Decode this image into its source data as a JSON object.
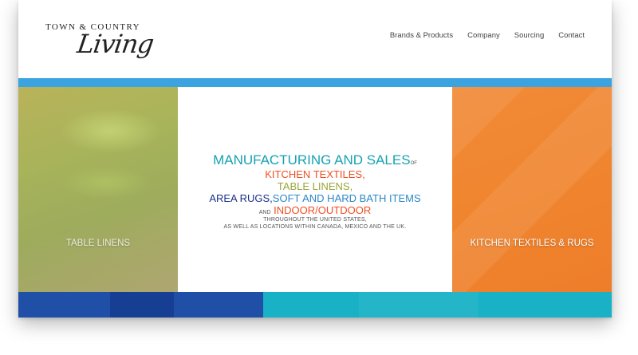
{
  "logo": {
    "top_text": "TOWN & COUNTRY",
    "script_text": "Living"
  },
  "nav": {
    "items": [
      "Brands & Products",
      "Company",
      "Sourcing",
      "Contact"
    ]
  },
  "hero": {
    "left_label": "TABLE LINENS",
    "right_label": "KITCHEN TEXTILES & RUGS",
    "line1_main": "MANUFACTURING AND SALES",
    "line1_of": "OF",
    "line2": "KITCHEN TEXTILES,",
    "line3": "TABLE LINENS,",
    "line4_a": "AREA RUGS,",
    "line4_b": "SOFT AND HARD BATH ITEMS",
    "line5_and": "AND",
    "line5_main": "INDOOR/OUTDOOR",
    "line6": "THROUGHOUT THE UNITED STATES,",
    "line7": "AS WELL AS LOCATIONS WITHIN CANADA, MEXICO AND THE UK."
  },
  "colors": {
    "accent_bar": "#3ba3e0",
    "teal": "#17a1b2",
    "orange_red": "#f04e23",
    "olive": "#9aa63a",
    "navy": "#1b2f8a",
    "blue": "#2b86c9",
    "right_panel": "#f0852f",
    "bottom_left": "#1f4fa6",
    "bottom_right": "#18b1c6"
  }
}
